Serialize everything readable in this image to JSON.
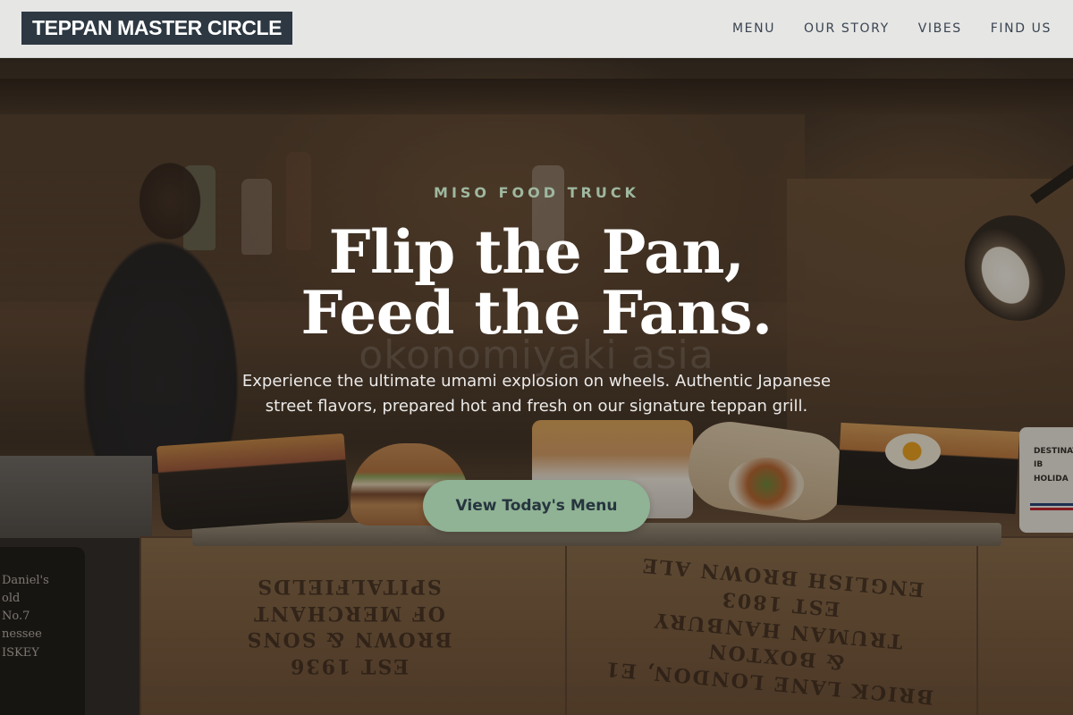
{
  "nav": {
    "brand": "TEPPAN MASTER CIRCLE",
    "links": [
      {
        "label": "MENU"
      },
      {
        "label": "OUR STORY"
      },
      {
        "label": "VIBES"
      },
      {
        "label": "FIND US"
      }
    ]
  },
  "hero": {
    "eyebrow": "MISO FOOD TRUCK",
    "headline_line1": "Flip the Pan,",
    "headline_line2": "Feed the Fans.",
    "subtext": "Experience the ultimate umami explosion on wheels. Authentic Japanese street flavors, prepared hot and fresh on our signature teppan grill.",
    "cta_label": "View Today's Menu"
  },
  "photo_text": {
    "watermark": "okonomiyaki asia",
    "can_label": "Daniel's\nold\nNo.7\nnessee\nISKEY",
    "crate_left": "EST 1936\nBROWN & SONS\nOF MERCHANT\nSPITALFIELDS",
    "crate_right": "BRICK LANE LONDON, E1\n& BOXTON\nTRUMAN HANBURY\nEST 1803\nENGLISH BROWN ALE",
    "mug_label": "DESTINAT\nIB\nHOLIDA"
  },
  "colors": {
    "nav_background": "#ececec",
    "brand_background": "#2d3842",
    "nav_link": "#3a4450",
    "eyebrow": "#9fb8a0",
    "cta_background": "#8fb394",
    "cta_text": "#27353f"
  }
}
